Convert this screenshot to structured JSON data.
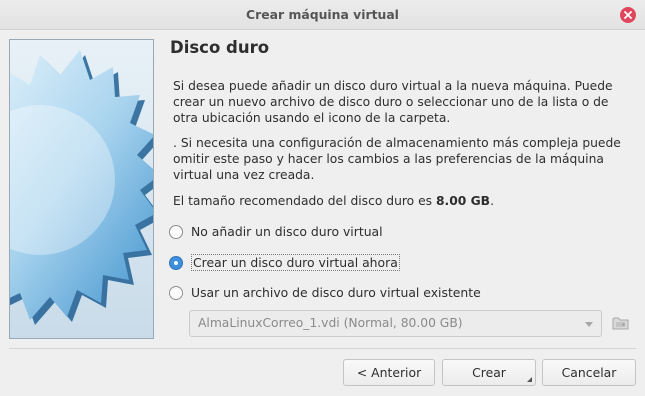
{
  "window": {
    "title": "Crear máquina virtual"
  },
  "page": {
    "heading": "Disco duro",
    "paragraph1": "Si desea puede añadir un disco duro virtual a la nueva máquina. Puede crear un nuevo archivo de disco duro o seleccionar uno de la lista o de otra ubicación usando el icono de la carpeta.",
    "paragraph2": ". Si necesita una configuración de almacenamiento más compleja puede omitir este paso y hacer los cambios a las preferencias de la máquina virtual una vez creada.",
    "recommended_prefix": "El tamaño recomendado del disco duro es ",
    "recommended_size": "8.00 GB",
    "recommended_suffix": "."
  },
  "options": [
    {
      "label": "No añadir un disco duro virtual",
      "checked": false
    },
    {
      "label": "Crear un disco duro virtual ahora",
      "checked": true
    },
    {
      "label": "Usar un archivo de disco duro virtual existente",
      "checked": false
    }
  ],
  "existing_disk": {
    "selected": "AlmaLinuxCorreo_1.vdi (Normal, 80.00 GB)",
    "enabled": false
  },
  "buttons": {
    "back": "< Anterior",
    "create": "Crear",
    "cancel": "Cancelar"
  },
  "colors": {
    "accent": "#3e8ede",
    "close": "#e0465e"
  },
  "icons": {
    "close": "close-icon",
    "folder": "folder-icon",
    "dropdown": "chevron-down-icon"
  }
}
